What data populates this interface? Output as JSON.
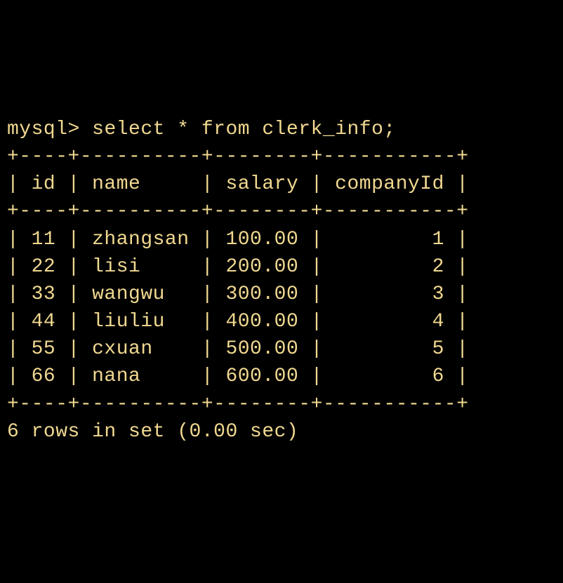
{
  "prompt": "mysql>",
  "query": "select * from clerk_info;",
  "border_top": "+----+----------+--------+-----------+",
  "border_mid": "+----+----------+--------+-----------+",
  "border_bot": "+----+----------+--------+-----------+",
  "header_line": "| id | name     | salary | companyId |",
  "columns": [
    "id",
    "name",
    "salary",
    "companyId"
  ],
  "rows": [
    {
      "id": "11",
      "name": "zhangsan",
      "salary": "100.00",
      "companyId": "1",
      "line": "| 11 | zhangsan | 100.00 |         1 |"
    },
    {
      "id": "22",
      "name": "lisi",
      "salary": "200.00",
      "companyId": "2",
      "line": "| 22 | lisi     | 200.00 |         2 |"
    },
    {
      "id": "33",
      "name": "wangwu",
      "salary": "300.00",
      "companyId": "3",
      "line": "| 33 | wangwu   | 300.00 |         3 |"
    },
    {
      "id": "44",
      "name": "liuliu",
      "salary": "400.00",
      "companyId": "4",
      "line": "| 44 | liuliu   | 400.00 |         4 |"
    },
    {
      "id": "55",
      "name": "cxuan",
      "salary": "500.00",
      "companyId": "5",
      "line": "| 55 | cxuan    | 500.00 |         5 |"
    },
    {
      "id": "66",
      "name": "nana",
      "salary": "600.00",
      "companyId": "6",
      "line": "| 66 | nana     | 600.00 |         6 |"
    }
  ],
  "footer": "6 rows in set (0.00 sec)"
}
